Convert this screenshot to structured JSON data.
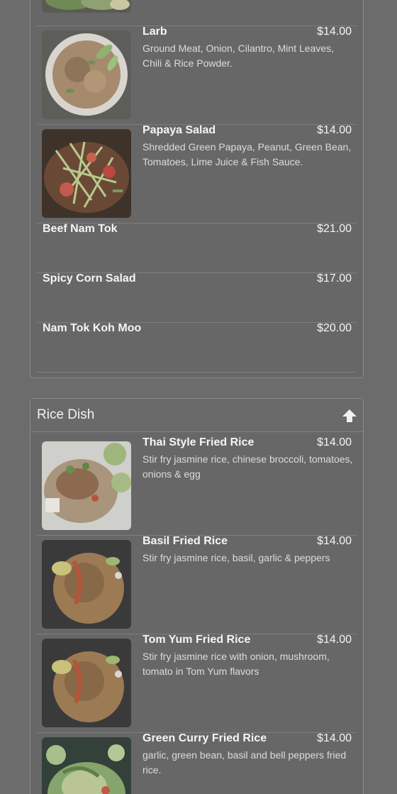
{
  "salad_section": {
    "items": [
      {
        "name": "",
        "price": "",
        "desc": ""
      },
      {
        "name": "Larb",
        "price": "$14.00",
        "desc": "Ground Meat, Onion, Cilantro, Mint Leaves, Chili & Rice Powder."
      },
      {
        "name": "Papaya Salad",
        "price": "$14.00",
        "desc": "Shredded Green Papaya, Peanut, Green Bean, Tomatoes, Lime Juice & Fish Sauce."
      },
      {
        "name": "Beef Nam Tok",
        "price": "$21.00",
        "desc": ""
      },
      {
        "name": "Spicy Corn Salad",
        "price": "$17.00",
        "desc": ""
      },
      {
        "name": "Nam Tok Koh Moo",
        "price": "$20.00",
        "desc": ""
      }
    ]
  },
  "rice_section": {
    "title": "Rice Dish",
    "items": [
      {
        "name": "Thai Style Fried Rice",
        "price": "$14.00",
        "desc": "Stir fry jasmine rice, chinese broccoli, tomatoes, onions & egg"
      },
      {
        "name": "Basil Fried Rice",
        "price": "$14.00",
        "desc": "Stir fry jasmine rice, basil, garlic & peppers"
      },
      {
        "name": "Tom Yum Fried Rice",
        "price": "$14.00",
        "desc": "Stir fry jasmine rice with onion, mushroom, tomato in Tom Yum flavors"
      },
      {
        "name": "Green Curry Fried Rice",
        "price": "$14.00",
        "desc": "garlic, green bean, basil and bell peppers fried rice."
      }
    ]
  },
  "icons": {
    "scroll_up": "arrow-up-icon"
  }
}
